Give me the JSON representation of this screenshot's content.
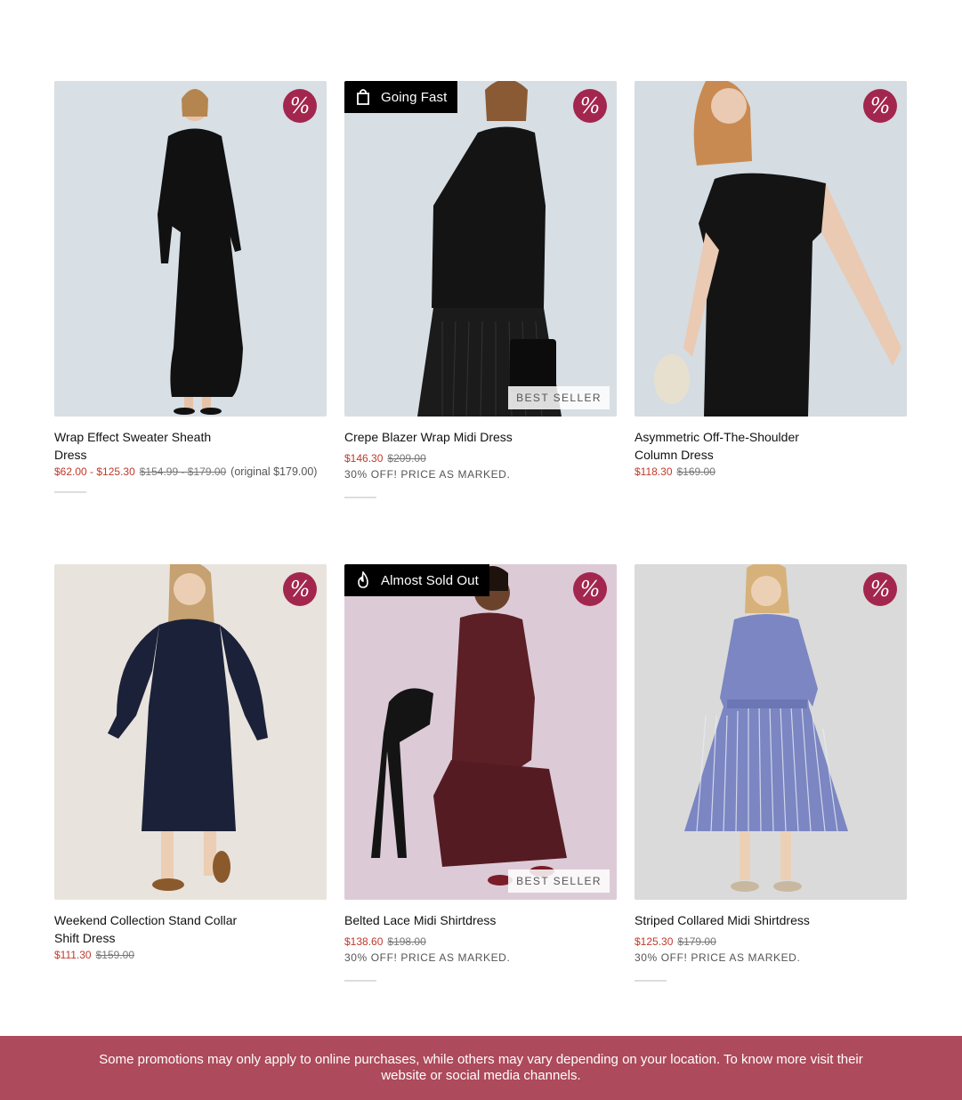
{
  "products": [
    {
      "name": "Wrap Effect Sweater Sheath Dress",
      "sale_price": "$62.00 - $125.30",
      "original_price": "$154.99 - $179.00",
      "note": "(original $179.00)",
      "promo": "",
      "flag": "",
      "best_seller": ""
    },
    {
      "name": "Crepe Blazer Wrap Midi Dress",
      "sale_price": "$146.30",
      "original_price": "$209.00",
      "note": "",
      "promo": "30% OFF! PRICE AS MARKED.",
      "flag": "Going Fast",
      "best_seller": "BEST SELLER"
    },
    {
      "name": "Asymmetric Off-The-Shoulder Column Dress",
      "sale_price": "$118.30",
      "original_price": "$169.00",
      "note": "",
      "promo": "",
      "flag": "",
      "best_seller": ""
    },
    {
      "name": "Weekend Collection Stand Collar Shift Dress",
      "sale_price": "$111.30",
      "original_price": "$159.00",
      "note": "",
      "promo": "",
      "flag": "",
      "best_seller": ""
    },
    {
      "name": "Belted Lace Midi Shirtdress",
      "sale_price": "$138.60",
      "original_price": "$198.00",
      "note": "",
      "promo": "30% OFF! PRICE AS MARKED.",
      "flag": "Almost Sold Out",
      "best_seller": "BEST SELLER"
    },
    {
      "name": "Striped Collared Midi Shirtdress",
      "sale_price": "$125.30",
      "original_price": "$179.00",
      "note": "",
      "promo": "30% OFF! PRICE AS MARKED.",
      "flag": "",
      "best_seller": ""
    }
  ],
  "sale_badge_symbol": "%",
  "colors": {
    "sale_badge": "#a3264f",
    "sale_price": "#c0392b",
    "banner": "#ad4a5b"
  },
  "banner": {
    "text": "Some promotions may only apply to online purchases, while others may vary depending on your location. To know more visit their website or social media channels."
  }
}
